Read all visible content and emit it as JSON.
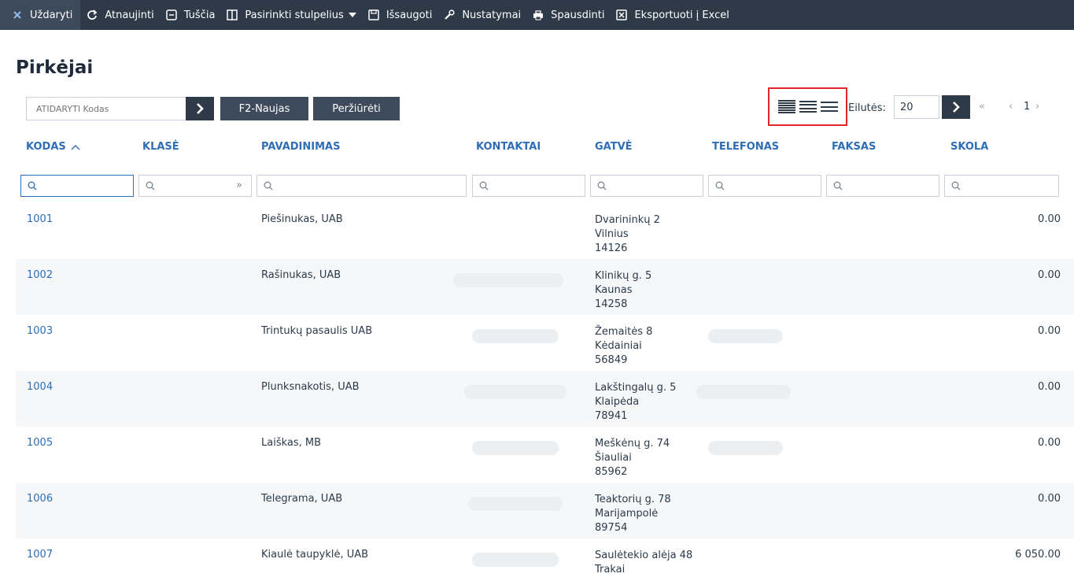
{
  "toolbar": {
    "items": [
      {
        "label": "Uždaryti",
        "icon": "close-icon"
      },
      {
        "label": "Atnaujinti",
        "icon": "refresh-icon"
      },
      {
        "label": "Tuščia",
        "icon": "blank-icon"
      },
      {
        "label": "Pasirinkti stulpelius",
        "icon": "columns-icon"
      },
      {
        "label": "Išsaugoti",
        "icon": "save-icon"
      },
      {
        "label": "Nustatymai",
        "icon": "wrench-icon"
      },
      {
        "label": "Spausdinti",
        "icon": "print-icon"
      },
      {
        "label": "Eksportuoti į Excel",
        "icon": "excel-icon"
      }
    ]
  },
  "page": {
    "title": "Pirkėjai"
  },
  "actions": {
    "open_placeholder": "ATIDARYTI Kodas",
    "new_label": "F2-Naujas",
    "view_label": "Peržiūrėti"
  },
  "pagination": {
    "rows_label": "Eilutės:",
    "rows_value": "20",
    "first": "«",
    "prev": "‹",
    "current": "1",
    "next": "›"
  },
  "table": {
    "columns": [
      {
        "label": "KODAS",
        "sorted": "asc"
      },
      {
        "label": "KLASĖ"
      },
      {
        "label": "PAVADINIMAS"
      },
      {
        "label": "KONTAKTAI"
      },
      {
        "label": "GATVĖ"
      },
      {
        "label": "TELEFONAS"
      },
      {
        "label": "FAKSAS"
      },
      {
        "label": "SKOLA"
      }
    ],
    "filter_more": "»",
    "rows": [
      {
        "code": "1001",
        "name": "Piešinukas, UAB",
        "street": "Dvarininkų 2",
        "city": "Vilnius",
        "zip": "14126",
        "skola": "0.00"
      },
      {
        "code": "1002",
        "name": "Rašinukas, UAB",
        "street": "Klinikų g. 5",
        "city": "Kaunas",
        "zip": "14258",
        "skola": "0.00"
      },
      {
        "code": "1003",
        "name": "Trintukų pasaulis UAB",
        "street": "Žemaitės 8",
        "city": "Kėdainiai",
        "zip": "56849",
        "skola": "0.00"
      },
      {
        "code": "1004",
        "name": "Plunksnakotis, UAB",
        "street": "Lakštingalų g. 5",
        "city": "Klaipėda",
        "zip": "78941",
        "skola": "0.00"
      },
      {
        "code": "1005",
        "name": "Laiškas, MB",
        "street": "Meškėnų g. 74",
        "city": "Šiauliai",
        "zip": "85962",
        "skola": "0.00"
      },
      {
        "code": "1006",
        "name": "Telegrama, UAB",
        "street": "Teaktorių g. 78",
        "city": "Marijampolė",
        "zip": "89754",
        "skola": "0.00"
      },
      {
        "code": "1007",
        "name": "Kiaulė taupyklė, UAB",
        "street": "Saulėtekio alėja 48",
        "city": "Trakai",
        "zip": "",
        "skola": "6 050.00"
      }
    ]
  },
  "colors": {
    "toolbar_bg": "#2f3a49",
    "link_blue": "#2f6db5",
    "highlight_red": "#e0262b"
  }
}
